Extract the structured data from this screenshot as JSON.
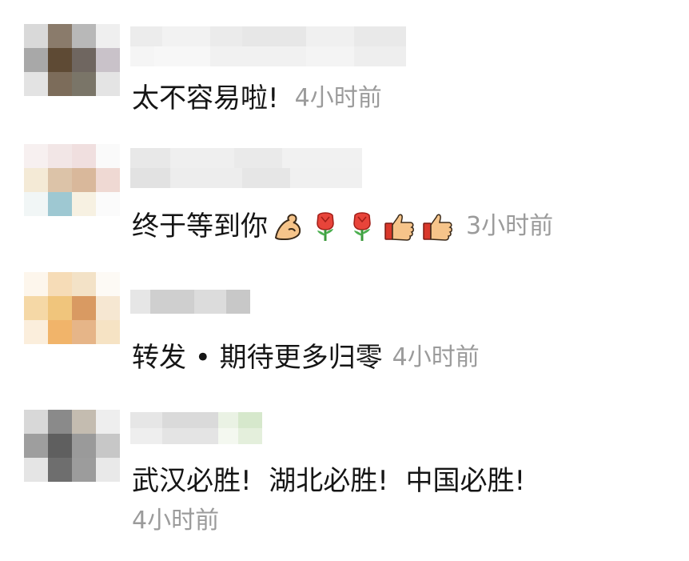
{
  "comments": [
    {
      "text": "太不容易啦!",
      "time": "4小时前"
    },
    {
      "text": "终于等到你",
      "time": "3小时前",
      "emojis": [
        "flexed-biceps",
        "rose",
        "rose",
        "thumbs-up",
        "thumbs-up"
      ]
    },
    {
      "text": "转发 • 期待更多归零",
      "time": "4小时前"
    },
    {
      "text": "武汉必胜!  湖北必胜!  中国必胜!",
      "time": "4小时前"
    }
  ],
  "colors": {
    "text": "#151515",
    "time": "#9b9b9b",
    "background": "#ffffff"
  }
}
